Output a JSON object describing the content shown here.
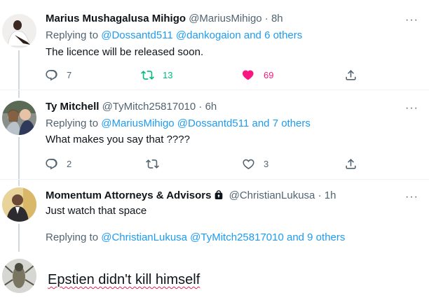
{
  "tweets": [
    {
      "name": "Marius Mushagalusa Mihigo",
      "handle": "@MariusMihigo",
      "dot": "·",
      "time": "8h",
      "replying_prefix": "Replying to ",
      "replying_mentions": "@Dossantd511 @dankogaion",
      "replying_suffix": " and 6 others",
      "text": "The licence will be released soon.",
      "replies": "7",
      "retweets": "13",
      "likes": "69",
      "liked": true,
      "retweeted": true
    },
    {
      "name": "Ty Mitchell",
      "handle": "@TyMitch25817010",
      "dot": "·",
      "time": "6h",
      "replying_prefix": "Replying to ",
      "replying_mentions": "@MariusMihigo @Dossantd511",
      "replying_suffix": " and 7 others",
      "text": "What makes you say that ????",
      "replies": "2",
      "retweets": "",
      "likes": "3",
      "liked": false,
      "retweeted": false
    },
    {
      "name": "Momentum Attorneys & Advisors",
      "handle": "@ChristianLukusa",
      "dot": "·",
      "time": "1h",
      "text": "Just watch that space",
      "replying_prefix": "Replying to ",
      "replying_mentions": "@ChristianLukusa @TyMitch25817010",
      "replying_suffix": " and 9 others"
    }
  ],
  "more_glyph": "···",
  "compose": {
    "text": "Epstien didn't kill himself"
  },
  "colors": {
    "accent": "#1d9bf0",
    "retweet": "#00ba7c",
    "like": "#f91880",
    "muted": "#536471"
  }
}
